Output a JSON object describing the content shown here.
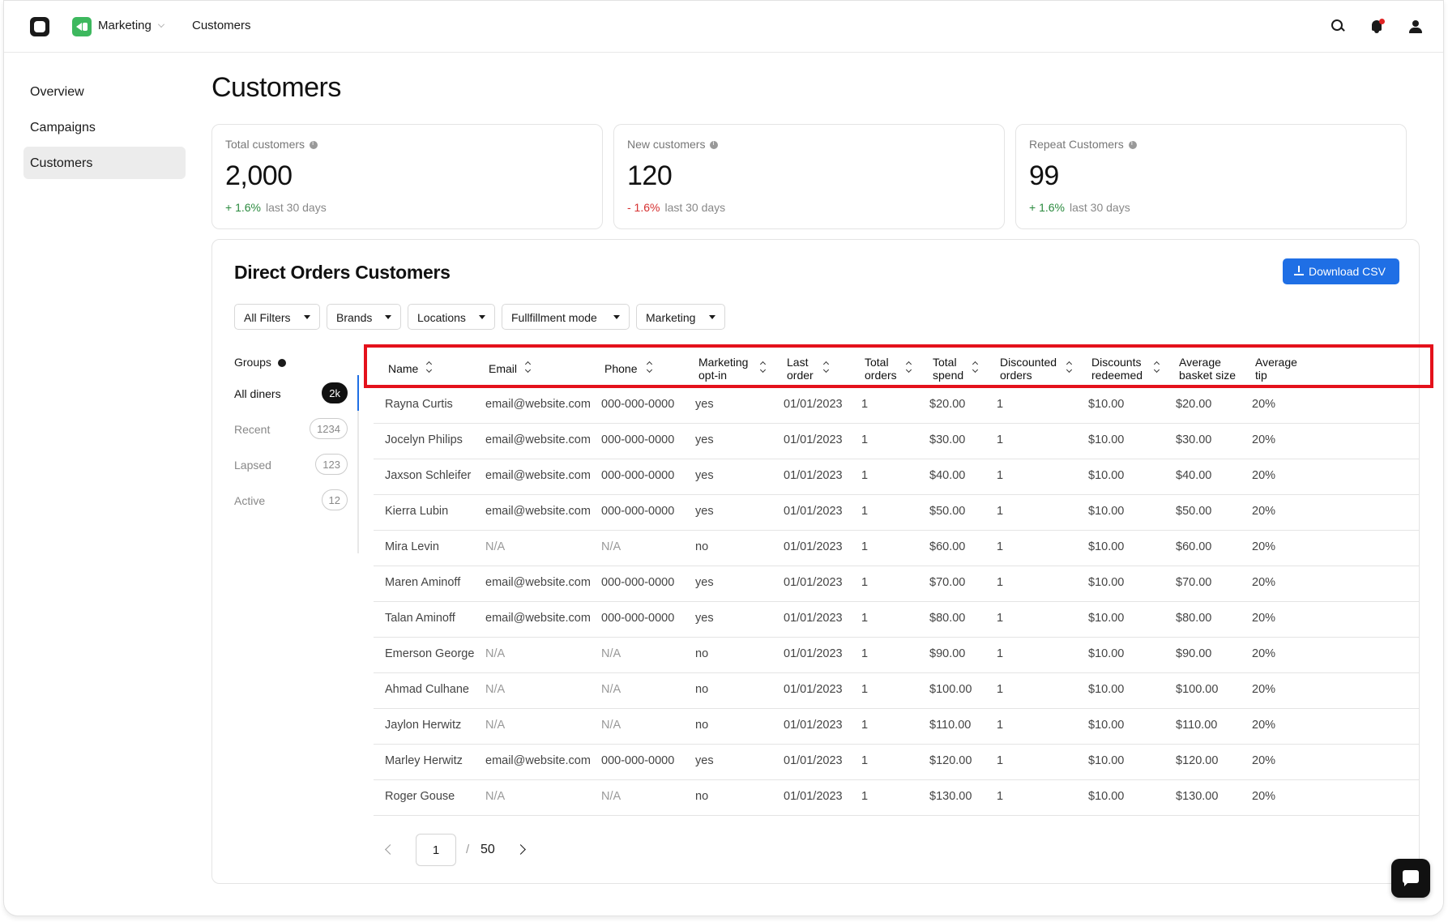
{
  "topbar": {
    "app_name": "Marketing",
    "breadcrumb": "Customers",
    "icons": [
      "app-logo",
      "marketing-icon",
      "search-icon",
      "bell-icon",
      "user-icon"
    ],
    "notification_dot_color": "#e02424"
  },
  "sidebar": {
    "items": [
      {
        "label": "Overview"
      },
      {
        "label": "Campaigns"
      },
      {
        "label": "Customers"
      }
    ],
    "active": "Customers"
  },
  "page": {
    "title": "Customers"
  },
  "stats": [
    {
      "label": "Total customers",
      "value": "2,000",
      "delta": "+ 1.6%",
      "period": "last 30 days",
      "trend": "up"
    },
    {
      "label": "New customers",
      "value": "120",
      "delta": "- 1.6%",
      "period": "last 30 days",
      "trend": "down"
    },
    {
      "label": "Repeat Customers",
      "value": "99",
      "delta": "+ 1.6%",
      "period": "last 30 days",
      "trend": "up"
    }
  ],
  "panel": {
    "title": "Direct Orders Customers",
    "download_label": "Download CSV",
    "filters": [
      "All Filters",
      "Brands",
      "Locations",
      "Fullfillment mode",
      "Marketing"
    ]
  },
  "groups": {
    "label": "Groups",
    "items": [
      {
        "name": "All diners",
        "count": "2k"
      },
      {
        "name": "Recent",
        "count": "1234"
      },
      {
        "name": "Lapsed",
        "count": "123"
      },
      {
        "name": "Active",
        "count": "12"
      }
    ],
    "active": "All diners"
  },
  "table": {
    "columns": [
      {
        "l1": "Name",
        "l2": ""
      },
      {
        "l1": "Email",
        "l2": ""
      },
      {
        "l1": "Phone",
        "l2": ""
      },
      {
        "l1": "Marketing",
        "l2": "opt-in"
      },
      {
        "l1": "Last",
        "l2": "order"
      },
      {
        "l1": "Total",
        "l2": "orders"
      },
      {
        "l1": "Total",
        "l2": "spend"
      },
      {
        "l1": "Discounted",
        "l2": "orders"
      },
      {
        "l1": "Discounts",
        "l2": "redeemed"
      },
      {
        "l1": "Average",
        "l2": "basket size"
      },
      {
        "l1": "Average",
        "l2": "tip"
      }
    ],
    "rows": [
      [
        "Rayna Curtis",
        "email@website.com",
        "000-000-0000",
        "yes",
        "01/01/2023",
        "1",
        "$20.00",
        "1",
        "$10.00",
        "$20.00",
        "20%"
      ],
      [
        "Jocelyn Philips",
        "email@website.com",
        "000-000-0000",
        "yes",
        "01/01/2023",
        "1",
        "$30.00",
        "1",
        "$10.00",
        "$30.00",
        "20%"
      ],
      [
        "Jaxson Schleifer",
        "email@website.com",
        "000-000-0000",
        "yes",
        "01/01/2023",
        "1",
        "$40.00",
        "1",
        "$10.00",
        "$40.00",
        "20%"
      ],
      [
        "Kierra Lubin",
        "email@website.com",
        "000-000-0000",
        "yes",
        "01/01/2023",
        "1",
        "$50.00",
        "1",
        "$10.00",
        "$50.00",
        "20%"
      ],
      [
        "Mira Levin",
        "N/A",
        "N/A",
        "no",
        "01/01/2023",
        "1",
        "$60.00",
        "1",
        "$10.00",
        "$60.00",
        "20%"
      ],
      [
        "Maren Aminoff",
        "email@website.com",
        "000-000-0000",
        "yes",
        "01/01/2023",
        "1",
        "$70.00",
        "1",
        "$10.00",
        "$70.00",
        "20%"
      ],
      [
        "Talan Aminoff",
        "email@website.com",
        "000-000-0000",
        "yes",
        "01/01/2023",
        "1",
        "$80.00",
        "1",
        "$10.00",
        "$80.00",
        "20%"
      ],
      [
        "Emerson George",
        "N/A",
        "N/A",
        "no",
        "01/01/2023",
        "1",
        "$90.00",
        "1",
        "$10.00",
        "$90.00",
        "20%"
      ],
      [
        "Ahmad Culhane",
        "N/A",
        "N/A",
        "no",
        "01/01/2023",
        "1",
        "$100.00",
        "1",
        "$10.00",
        "$100.00",
        "20%"
      ],
      [
        "Jaylon Herwitz",
        "N/A",
        "N/A",
        "no",
        "01/01/2023",
        "1",
        "$110.00",
        "1",
        "$10.00",
        "$110.00",
        "20%"
      ],
      [
        "Marley Herwitz",
        "email@website.com",
        "000-000-0000",
        "yes",
        "01/01/2023",
        "1",
        "$120.00",
        "1",
        "$10.00",
        "$120.00",
        "20%"
      ],
      [
        "Roger Gouse",
        "N/A",
        "N/A",
        "no",
        "01/01/2023",
        "1",
        "$130.00",
        "1",
        "$10.00",
        "$130.00",
        "20%"
      ]
    ]
  },
  "pagination": {
    "current": "1",
    "separator": "/",
    "total": "50"
  },
  "colors": {
    "accent": "#1f6fe5",
    "positive": "#2a8a3e",
    "negative": "#d63030",
    "highlight": "#e4111b"
  }
}
